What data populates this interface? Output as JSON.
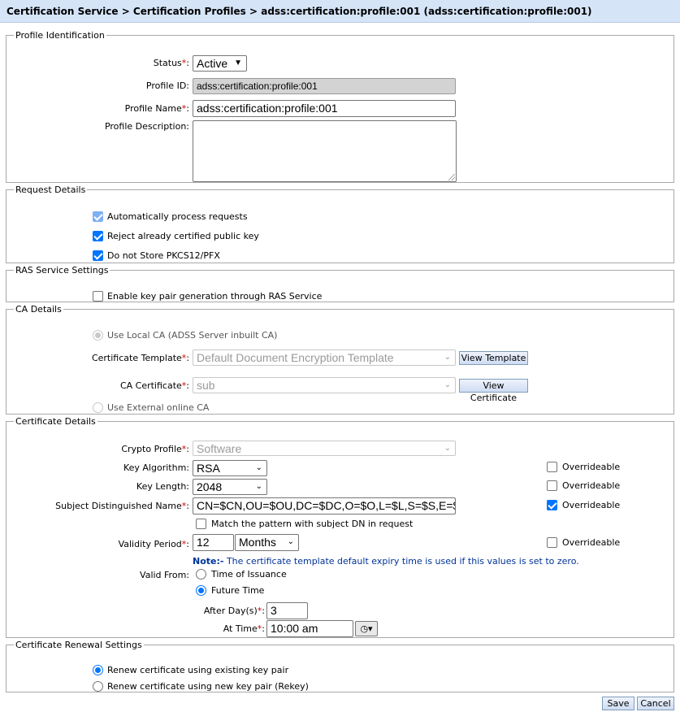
{
  "breadcrumb": "Certification Service > Certification Profiles > adss:certification:profile:001 (adss:certification:profile:001)",
  "profile_identification": {
    "legend": "Profile Identification",
    "status_label": "Status",
    "status_value": "Active",
    "profile_id_label": "Profile ID:",
    "profile_id_value": "adss:certification:profile:001",
    "profile_name_label": "Profile Name",
    "profile_name_value": "adss:certification:profile:001",
    "profile_description_label": "Profile Description:",
    "profile_description_value": ""
  },
  "request_details": {
    "legend": "Request Details",
    "auto_process": "Automatically process requests",
    "reject_certified": "Reject already certified public key",
    "no_store_pkcs12": "Do not Store PKCS12/PFX"
  },
  "ras_settings": {
    "legend": "RAS Service Settings",
    "enable_ras": "Enable key pair generation through RAS Service"
  },
  "ca_details": {
    "legend": "CA Details",
    "use_local_ca": "Use Local CA (ADSS Server inbuilt CA)",
    "cert_template_label": "Certificate Template",
    "cert_template_value": "Default Document Encryption Template",
    "view_template": "View Template",
    "ca_cert_label": "CA Certificate",
    "ca_cert_value": "sub",
    "view_certificate": "View Certificate",
    "use_external_ca": "Use External online CA"
  },
  "certificate_details": {
    "legend": "Certificate Details",
    "crypto_profile_label": "Crypto Profile",
    "crypto_profile_value": "Software",
    "key_algorithm_label": "Key Algorithm:",
    "key_algorithm_value": "RSA",
    "key_length_label": "Key Length:",
    "key_length_value": "2048",
    "subject_dn_label": "Subject Distinguished Name",
    "subject_dn_value": "CN=$CN,OU=$OU,DC=$DC,O=$O,L=$L,S=$S,E=$E",
    "match_pattern": "Match the pattern with subject DN in request",
    "validity_label": "Validity Period",
    "validity_value": "12",
    "validity_unit": "Months",
    "overrideable": "Overrideable",
    "note_prefix": "Note:-",
    "note_text": " The certificate template default expiry time is used if this values is set to zero.",
    "valid_from_label": "Valid From:",
    "time_of_issuance": "Time of Issuance",
    "future_time": "Future Time",
    "after_days_label": "After Day(s)",
    "after_days_value": "3",
    "at_time_label": "At Time",
    "at_time_value": "10:00 am"
  },
  "renewal": {
    "legend": "Certificate Renewal Settings",
    "existing_key": "Renew certificate using existing key pair",
    "new_key": "Renew certificate using new key pair (Rekey)"
  },
  "footer": {
    "save": "Save",
    "cancel": "Cancel"
  },
  "required_mark": "*",
  "colon": ":"
}
